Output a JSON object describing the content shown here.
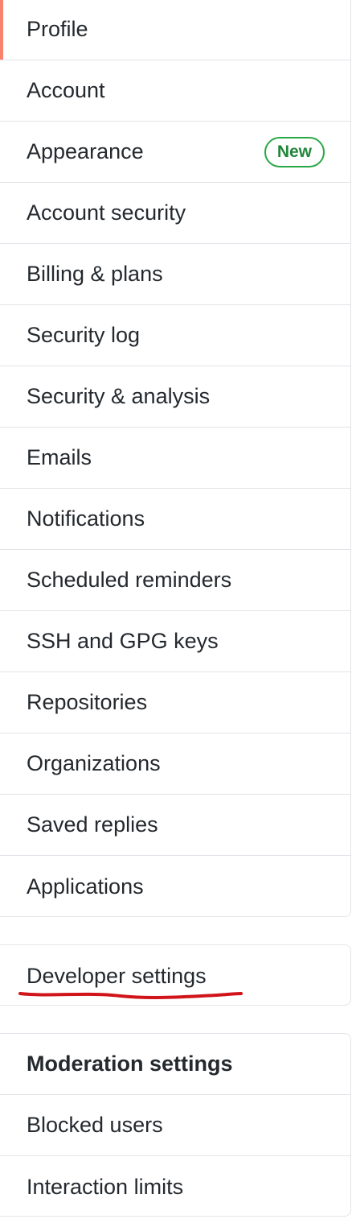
{
  "menu": {
    "items": [
      {
        "label": "Profile"
      },
      {
        "label": "Account"
      },
      {
        "label": "Appearance",
        "badge": "New"
      },
      {
        "label": "Account security"
      },
      {
        "label": "Billing & plans"
      },
      {
        "label": "Security log"
      },
      {
        "label": "Security & analysis"
      },
      {
        "label": "Emails"
      },
      {
        "label": "Notifications"
      },
      {
        "label": "Scheduled reminders"
      },
      {
        "label": "SSH and GPG keys"
      },
      {
        "label": "Repositories"
      },
      {
        "label": "Organizations"
      },
      {
        "label": "Saved replies"
      },
      {
        "label": "Applications"
      }
    ]
  },
  "developer": {
    "label": "Developer settings"
  },
  "moderation": {
    "heading": "Moderation settings",
    "items": [
      {
        "label": "Blocked users"
      },
      {
        "label": "Interaction limits"
      }
    ]
  },
  "colors": {
    "selected_indicator": "#f9826c",
    "badge_green": "#28a745",
    "annotation_red": "#d0141a",
    "border": "#e1e4e8"
  }
}
